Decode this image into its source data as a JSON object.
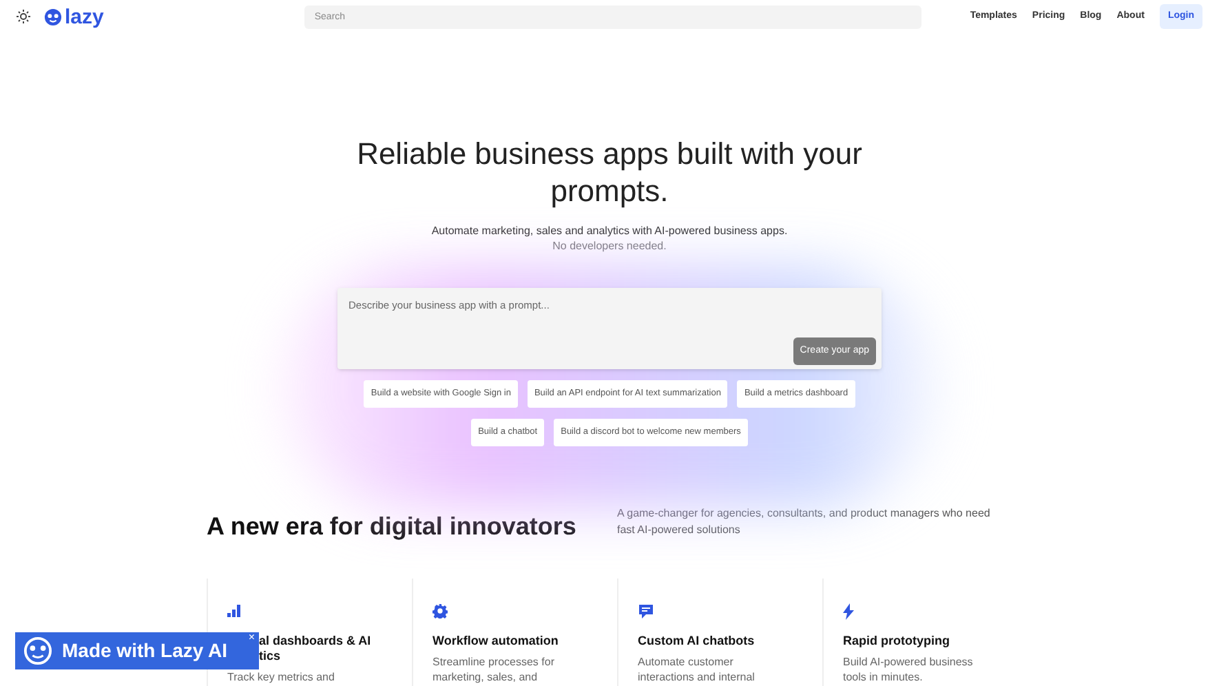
{
  "header": {
    "search": {
      "placeholder": "Search"
    },
    "logo": "lazy",
    "nav": [
      "Templates",
      "Pricing",
      "Blog",
      "About"
    ],
    "login": "Login"
  },
  "hero": {
    "title": "Reliable business apps built with your prompts.",
    "subtitle": "Automate marketing, sales and analytics with AI-powered business apps.",
    "subtitle_2": "No developers needed.",
    "prompt": {
      "placeholder": "Describe your business app with a prompt..."
    },
    "create_button": "Create your app",
    "suggestions": [
      [
        "Build a website with Google Sign in",
        "Build an API endpoint for AI text summarization",
        "Build a metrics dashboard"
      ],
      [
        "Build a chatbot",
        "Build a discord bot to welcome new members"
      ]
    ]
  },
  "section": {
    "title": "A new era for digital innovators",
    "description": "A game-changer for agencies, consultants, and product managers who need fast AI-powered solutions"
  },
  "features": [
    {
      "kind": "chart",
      "title_lines": [
        "al dashboards & AI",
        "tics"
      ],
      "covered": true,
      "description": "Track key metrics and"
    },
    {
      "kind": "gear",
      "title_lines": [
        "Workflow automation"
      ],
      "covered": false,
      "description": "Streamline processes for marketing, sales, and"
    },
    {
      "kind": "chat",
      "title_lines": [
        "Custom AI chatbots"
      ],
      "covered": false,
      "description": "Automate customer interactions and internal"
    },
    {
      "kind": "bolt",
      "title_lines": [
        "Rapid prototyping"
      ],
      "covered": false,
      "description": "Build AI-powered business tools in minutes."
    }
  ],
  "badge": {
    "label": "Made with Lazy AI",
    "close": "×"
  }
}
